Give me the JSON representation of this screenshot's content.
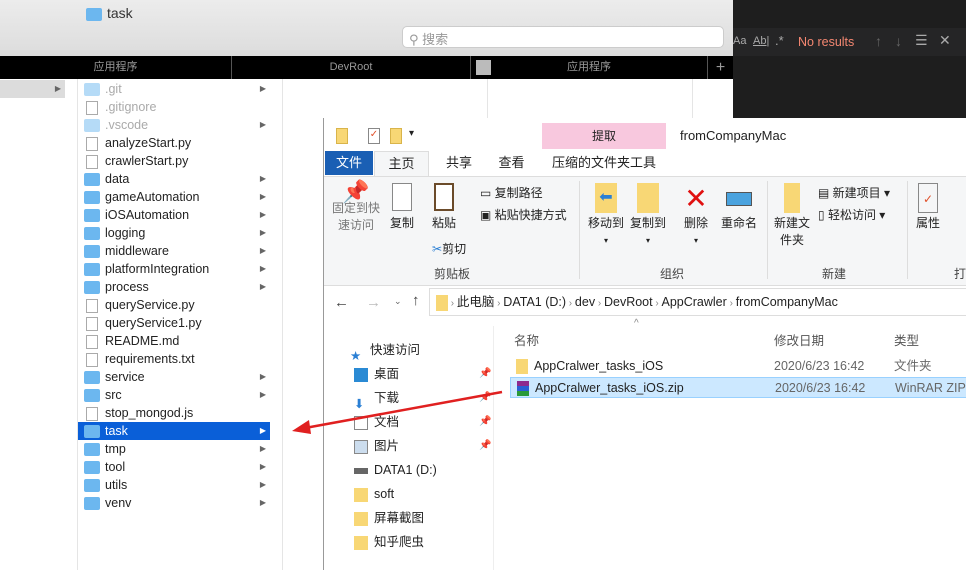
{
  "finder": {
    "title": "task",
    "search_placeholder": "搜索",
    "tabs": [
      "应用程序",
      "DevRoot",
      "应用程序"
    ],
    "add_tab": "+",
    "items": [
      {
        "name": ".git",
        "folder": true,
        "dim": true
      },
      {
        "name": ".gitignore",
        "folder": false,
        "dim": true
      },
      {
        "name": ".vscode",
        "folder": true,
        "dim": true
      },
      {
        "name": "analyzeStart.py",
        "folder": false
      },
      {
        "name": "crawlerStart.py",
        "folder": false
      },
      {
        "name": "data",
        "folder": true
      },
      {
        "name": "gameAutomation",
        "folder": true
      },
      {
        "name": "iOSAutomation",
        "folder": true
      },
      {
        "name": "logging",
        "folder": true
      },
      {
        "name": "middleware",
        "folder": true
      },
      {
        "name": "platformIntegration",
        "folder": true
      },
      {
        "name": "process",
        "folder": true
      },
      {
        "name": "queryService.py",
        "folder": false
      },
      {
        "name": "queryService1.py",
        "folder": false
      },
      {
        "name": "README.md",
        "folder": false
      },
      {
        "name": "requirements.txt",
        "folder": false
      },
      {
        "name": "service",
        "folder": true
      },
      {
        "name": "src",
        "folder": true
      },
      {
        "name": "stop_mongod.js",
        "folder": false
      },
      {
        "name": "task",
        "folder": true,
        "selected": true
      },
      {
        "name": "tmp",
        "folder": true
      },
      {
        "name": "tool",
        "folder": true
      },
      {
        "name": "utils",
        "folder": true
      },
      {
        "name": "venv",
        "folder": true
      }
    ]
  },
  "find_widget": {
    "case": "Aa",
    "word": "Ab|",
    "regex": ".*",
    "status": "No results",
    "status_color": "#f48771"
  },
  "explorer": {
    "title": "fromCompanyMac",
    "context_tab": "提取",
    "context_group": "压缩的文件夹工具",
    "tabs": [
      "文件",
      "主页",
      "共享",
      "查看"
    ],
    "ribbon": {
      "pin": "固定到快速访问",
      "copy": "复制",
      "paste": "粘贴",
      "copy_path": "复制路径",
      "paste_shortcut": "粘贴快捷方式",
      "cut": "剪切",
      "clipboard": "剪贴板",
      "move_to": "移动到",
      "copy_to": "复制到",
      "delete": "删除",
      "rename": "重命名",
      "organize": "组织",
      "new_folder": "新建文件夹",
      "new_item": "新建项目",
      "easy_access": "轻松访问",
      "new": "新建",
      "properties": "属性",
      "open": "打"
    },
    "breadcrumb": [
      "此电脑",
      "DATA1 (D:)",
      "dev",
      "DevRoot",
      "AppCrawler",
      "fromCompanyMac"
    ],
    "columns": [
      "名称",
      "修改日期",
      "类型"
    ],
    "files": [
      {
        "name": "AppCralwer_tasks_iOS",
        "date": "2020/6/23 16:42",
        "type": "文件夹"
      },
      {
        "name": "AppCralwer_tasks_iOS.zip",
        "date": "2020/6/23 16:42",
        "type": "WinRAR ZIP",
        "selected": true
      }
    ],
    "nav": [
      {
        "label": "快速访问",
        "icon": "star"
      },
      {
        "label": "桌面",
        "icon": "desktop",
        "pin": true
      },
      {
        "label": "下载",
        "icon": "download",
        "pin": true
      },
      {
        "label": "文档",
        "icon": "document",
        "pin": true
      },
      {
        "label": "图片",
        "icon": "pictures",
        "pin": true
      },
      {
        "label": "DATA1 (D:)",
        "icon": "drive"
      },
      {
        "label": "soft",
        "icon": "folder"
      },
      {
        "label": "屏幕截图",
        "icon": "folder"
      },
      {
        "label": "知乎爬虫",
        "icon": "folder"
      }
    ]
  },
  "arrow_color": "#e02020"
}
